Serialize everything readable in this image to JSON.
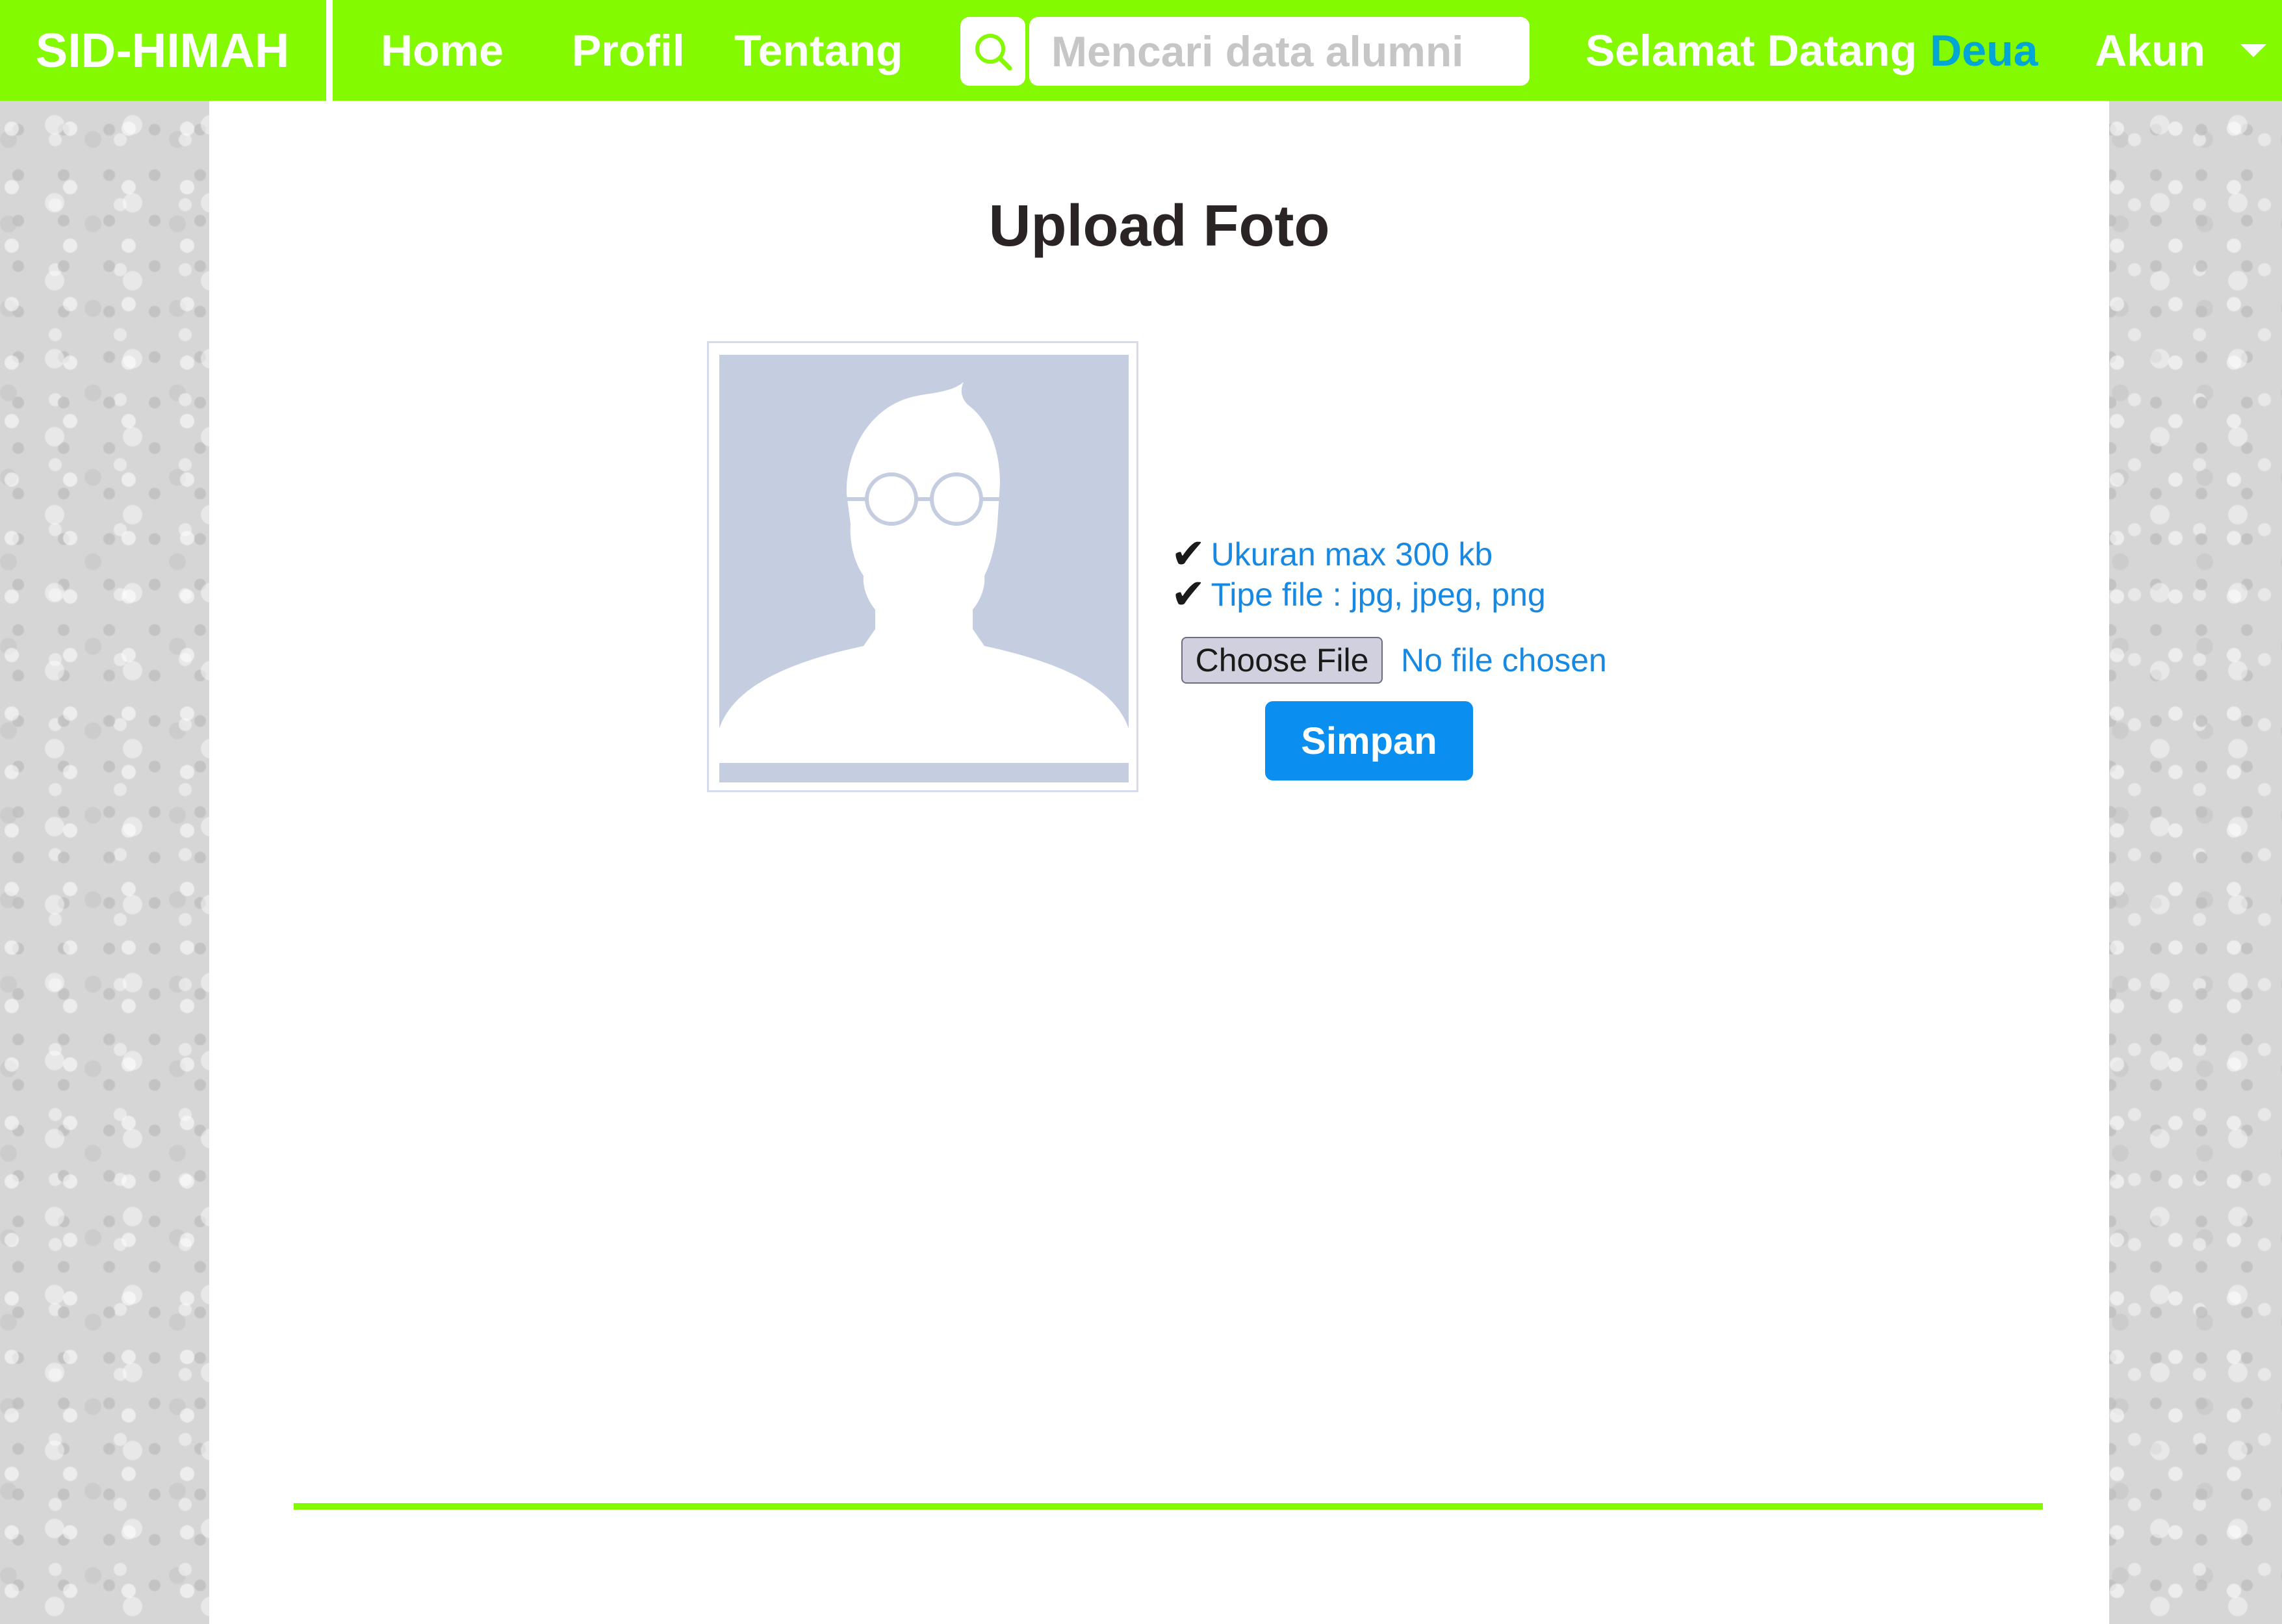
{
  "navbar": {
    "brand": "SID-HIMAH",
    "links": [
      "Home",
      "Profil",
      "Tentang"
    ],
    "search_placeholder": "Mencari data alumni",
    "search_icon": "search-icon",
    "welcome_text": "Selamat Datang",
    "username": "Deua",
    "account_label": "Akun",
    "account_icon": "caret-down-icon"
  },
  "colors": {
    "navbar": "#84fa00",
    "accent_blue": "#0a8ef0",
    "username": "#00a6d6",
    "footer_line": "#84fa00"
  },
  "main": {
    "title": "Upload Foto",
    "avatar_icon": "profile-placeholder-icon",
    "requirements": [
      "Ukuran max 300 kb",
      "Tipe file : jpg, jpeg, png"
    ],
    "requirement_icon": "checkmark-icon",
    "file_button_label": "Choose File",
    "file_status": "No file chosen",
    "save_label": "Simpan"
  }
}
